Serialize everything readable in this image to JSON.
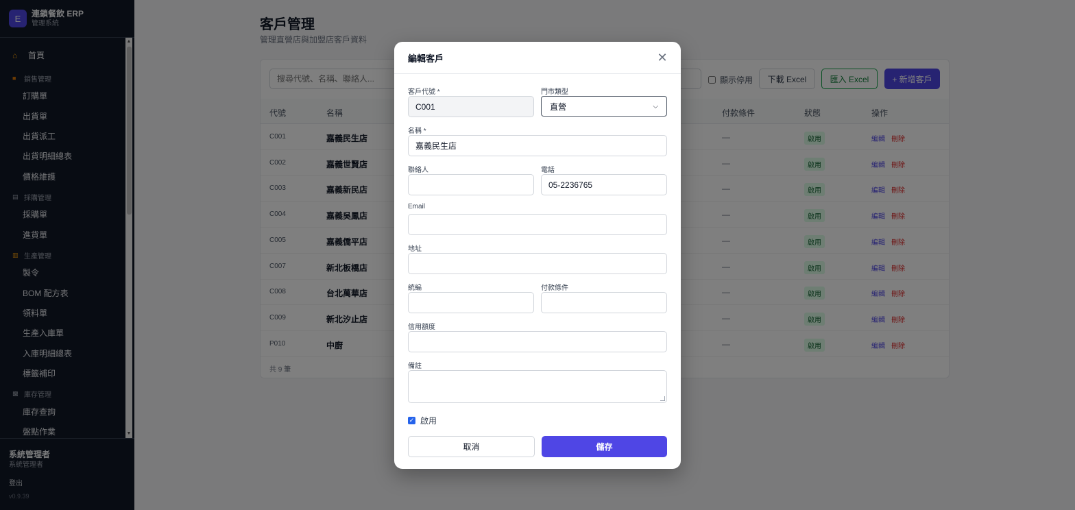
{
  "sidebar": {
    "logo_letter": "E",
    "app_name": "連鎖餐飲 ERP",
    "app_sub": "管理系統",
    "home": "首頁",
    "groups": [
      {
        "label": "銷售管理",
        "icon": "box-icon",
        "items": [
          "訂購單",
          "出貨單",
          "出貨派工",
          "出貨明細總表",
          "價格維護"
        ]
      },
      {
        "label": "採購管理",
        "icon": "cart-icon",
        "items": [
          "採購單",
          "進貨單"
        ]
      },
      {
        "label": "生產管理",
        "icon": "factory-icon",
        "items": [
          "製令",
          "BOM 配方表",
          "領料單",
          "生產入庫單",
          "入庫明細總表",
          "標籤補印"
        ]
      },
      {
        "label": "庫存管理",
        "icon": "warehouse-icon",
        "items": [
          "庫存查詢",
          "盤點作業"
        ]
      }
    ],
    "user_name": "系統管理者",
    "user_role": "系統管理者",
    "logout": "登出",
    "version": "v0.9.39"
  },
  "page": {
    "title": "客戶管理",
    "subtitle": "管理直營店與加盟店客戶資料"
  },
  "toolbar": {
    "search_placeholder": "搜尋代號、名稱、聯絡人...",
    "show_disabled": "顯示停用",
    "download": "下載 Excel",
    "import": "匯入 Excel",
    "add": "+ 新增客戶"
  },
  "table": {
    "headers": {
      "code": "代號",
      "name": "名稱",
      "payment": "付款條件",
      "status": "狀態",
      "actions": "操作"
    },
    "rows": [
      {
        "code": "C001",
        "name": "嘉義民生店",
        "payment": "—",
        "status": "啟用"
      },
      {
        "code": "C002",
        "name": "嘉義世賢店",
        "payment": "—",
        "status": "啟用"
      },
      {
        "code": "C003",
        "name": "嘉義新民店",
        "payment": "—",
        "status": "啟用"
      },
      {
        "code": "C004",
        "name": "嘉義吳鳳店",
        "payment": "—",
        "status": "啟用"
      },
      {
        "code": "C005",
        "name": "嘉義僑平店",
        "payment": "—",
        "status": "啟用"
      },
      {
        "code": "C007",
        "name": "新北板橋店",
        "payment": "—",
        "status": "啟用"
      },
      {
        "code": "C008",
        "name": "台北萬華店",
        "payment": "—",
        "status": "啟用"
      },
      {
        "code": "C009",
        "name": "新北汐止店",
        "payment": "—",
        "status": "啟用"
      },
      {
        "code": "P010",
        "name": "中廚",
        "payment": "—",
        "status": "啟用"
      }
    ],
    "edit_label": "編輯",
    "delete_label": "刪除",
    "total": "共 9 筆"
  },
  "modal": {
    "title": "編輯客戶",
    "fields": {
      "code_label": "客戶代號 *",
      "code_value": "C001",
      "type_label": "門市類型",
      "type_value": "直營",
      "name_label": "名稱 *",
      "name_value": "嘉義民生店",
      "contact_label": "聯絡人",
      "contact_value": "",
      "phone_label": "電話",
      "phone_value": "05-2236765",
      "email_label": "Email",
      "email_value": "",
      "address_label": "地址",
      "address_value": "",
      "tax_label": "統編",
      "tax_value": "",
      "payment_label": "付款條件",
      "payment_value": "",
      "credit_label": "信用額度",
      "credit_value": "",
      "note_label": "備註",
      "note_value": ""
    },
    "enabled_label": "啟用",
    "cancel": "取消",
    "save": "儲存"
  },
  "colors": {
    "accent": "#4f46e5",
    "sidebar_bg": "#111827",
    "status_green": "#dcfce7"
  }
}
